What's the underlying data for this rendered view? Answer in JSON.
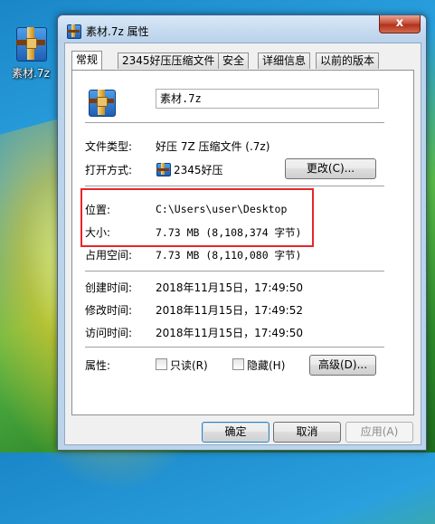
{
  "desktop": {
    "icon_label": "素材.7z",
    "icon_name": "winrar-archive-icon"
  },
  "window": {
    "title": "素材.7z 属性",
    "close_label": "x"
  },
  "tabs": [
    {
      "label": "常规",
      "active": true
    },
    {
      "label": "2345好压压缩文件",
      "active": false
    },
    {
      "label": "安全",
      "active": false
    },
    {
      "label": "详细信息",
      "active": false
    },
    {
      "label": "以前的版本",
      "active": false
    }
  ],
  "general": {
    "file_name": "素材.7z",
    "type_label": "文件类型:",
    "type_value": "好压 7Z 压缩文件 (.7z)",
    "open_with_label": "打开方式:",
    "open_with_value": "2345好压",
    "change_button": "更改(C)...",
    "location_label": "位置:",
    "location_value": "C:\\Users\\user\\Desktop",
    "size_label": "大小:",
    "size_value": "7.73 MB (8,108,374 字节)",
    "size_on_disk_label": "占用空间:",
    "size_on_disk_value": "7.73 MB (8,110,080 字节)",
    "created_label": "创建时间:",
    "created_value": "2018年11月15日，17:49:50",
    "modified_label": "修改时间:",
    "modified_value": "2018年11月15日，17:49:52",
    "accessed_label": "访问时间:",
    "accessed_value": "2018年11月15日，17:49:50",
    "attributes_label": "属性:",
    "readonly_label": "只读(R)",
    "hidden_label": "隐藏(H)",
    "advanced_button": "高级(D)..."
  },
  "footer": {
    "ok": "确定",
    "cancel": "取消",
    "apply": "应用(A)"
  },
  "colors": {
    "highlight_box": "#e5262c"
  }
}
